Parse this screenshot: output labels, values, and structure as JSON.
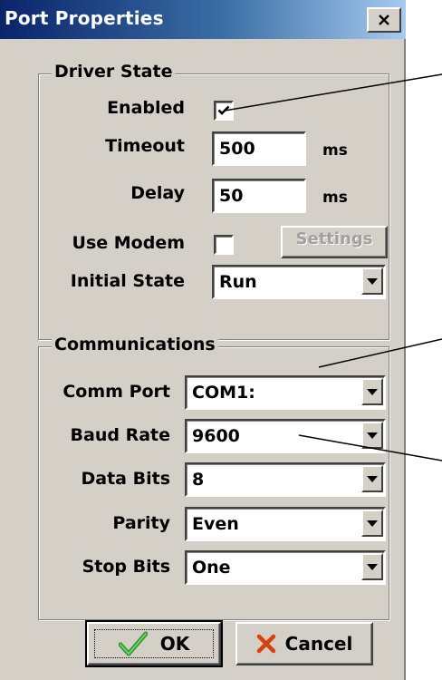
{
  "window": {
    "title": "Port Properties"
  },
  "driver_state": {
    "group_title": "Driver State",
    "enabled": {
      "label": "Enabled",
      "checked": true
    },
    "timeout": {
      "label": "Timeout",
      "value": "500",
      "unit": "ms"
    },
    "delay": {
      "label": "Delay",
      "value": "50",
      "unit": "ms"
    },
    "use_modem": {
      "label": "Use Modem",
      "checked": false,
      "settings_label": "Settings"
    },
    "initial_state": {
      "label": "Initial State",
      "value": "Run"
    }
  },
  "communications": {
    "group_title": "Communications",
    "comm_port": {
      "label": "Comm Port",
      "value": "COM1:"
    },
    "baud_rate": {
      "label": "Baud Rate",
      "value": "9600"
    },
    "data_bits": {
      "label": "Data Bits",
      "value": "8"
    },
    "parity": {
      "label": "Parity",
      "value": "Even"
    },
    "stop_bits": {
      "label": "Stop Bits",
      "value": "One"
    }
  },
  "buttons": {
    "ok": "OK",
    "cancel": "Cancel"
  },
  "colors": {
    "dialog_bg": "#d4d0c8",
    "titlebar_start": "#0a246a",
    "titlebar_end": "#a6caf0",
    "ok_check": "#2e9a2e",
    "cancel_x": "#d84010"
  }
}
